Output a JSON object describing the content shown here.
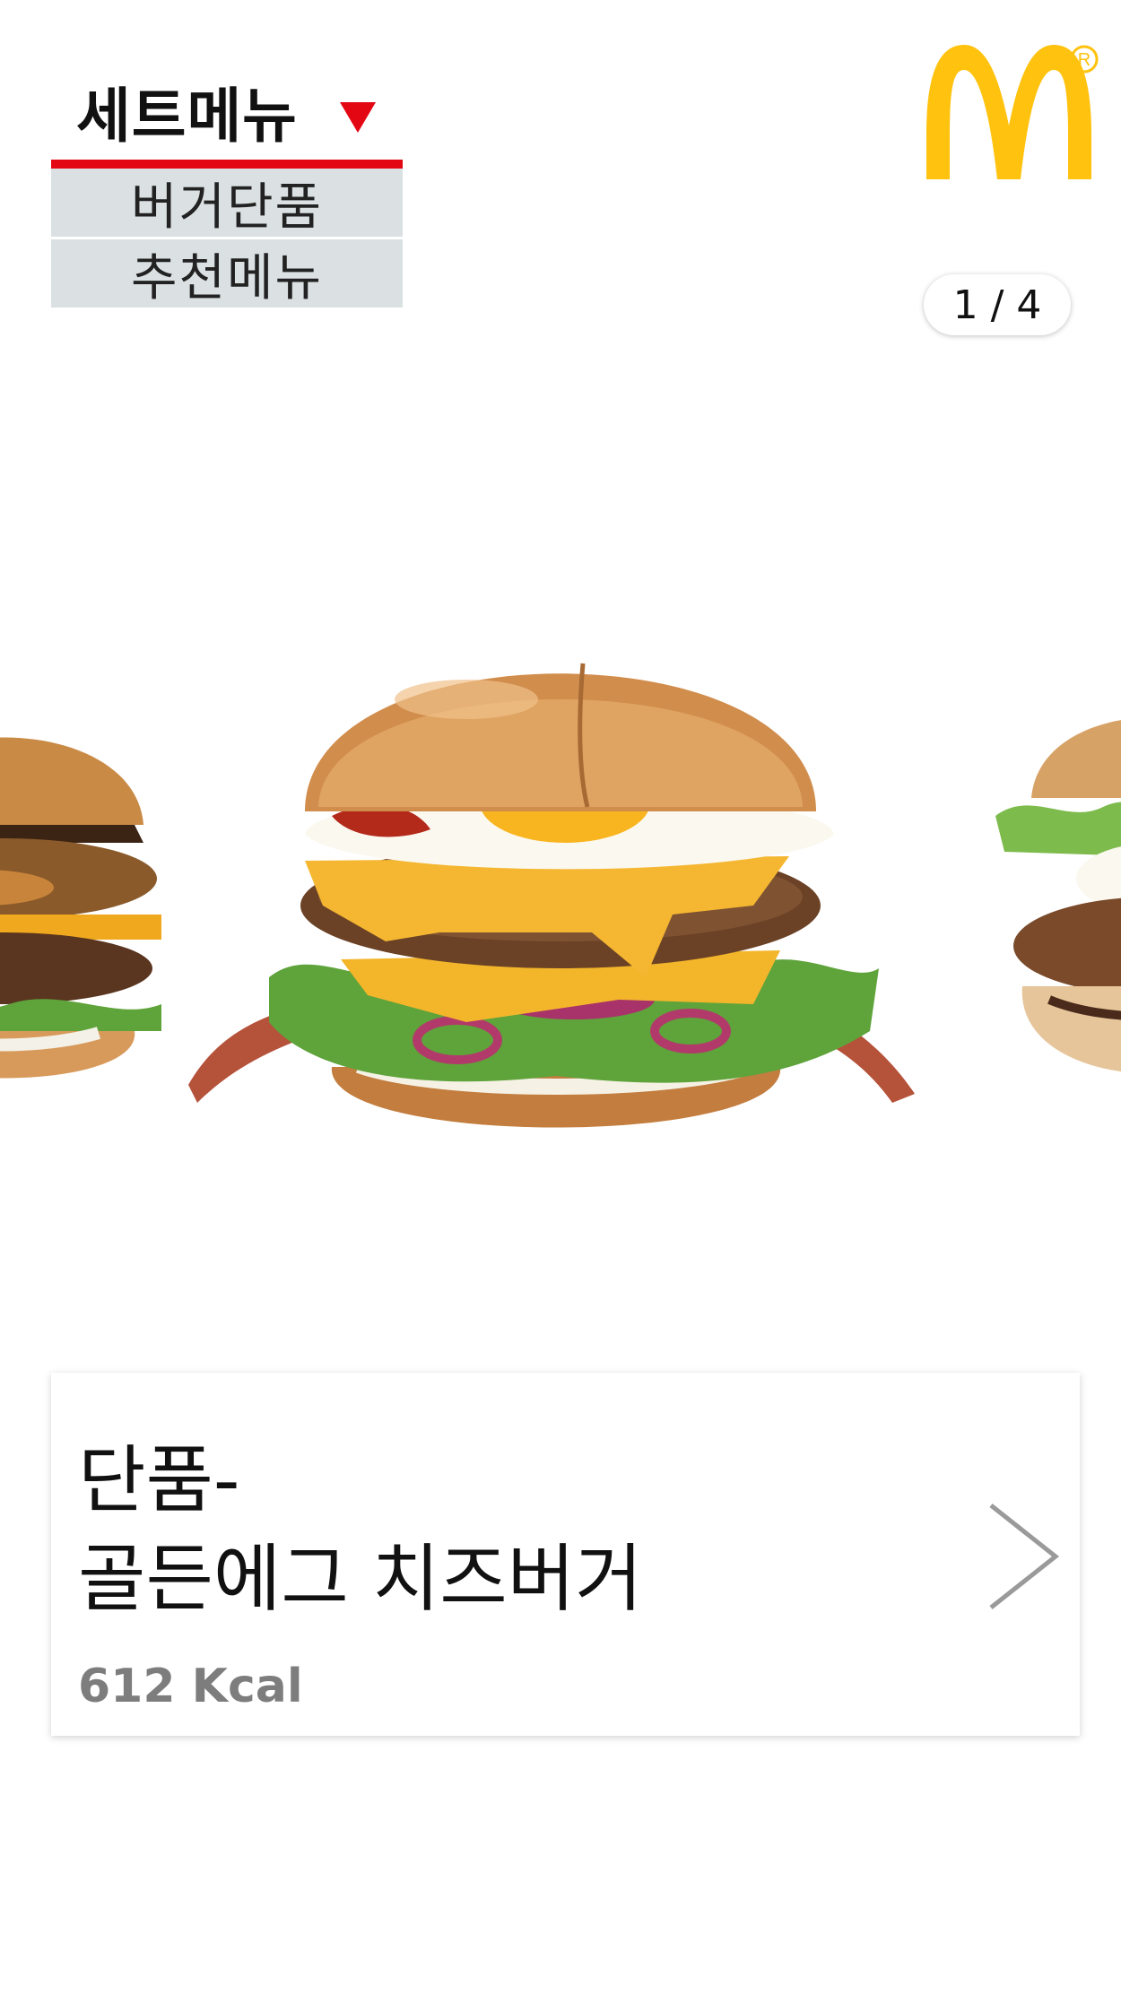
{
  "menu": {
    "selected_label": "세트메뉴",
    "options": [
      "버거단품",
      "추천메뉴"
    ],
    "accent_color": "#e30613"
  },
  "logo": {
    "icon": "golden-arches-logo",
    "registered_mark": "R",
    "color": "#ffc20e"
  },
  "pager": {
    "text": "1 / 4"
  },
  "carousel": {
    "items": [
      "burger-image-previous",
      "burger-image-golden-egg-cheese",
      "burger-image-next"
    ]
  },
  "product": {
    "title_line1": "단품-",
    "title_line2": "골든에그 치즈버거",
    "kcal": "612 Kcal"
  }
}
